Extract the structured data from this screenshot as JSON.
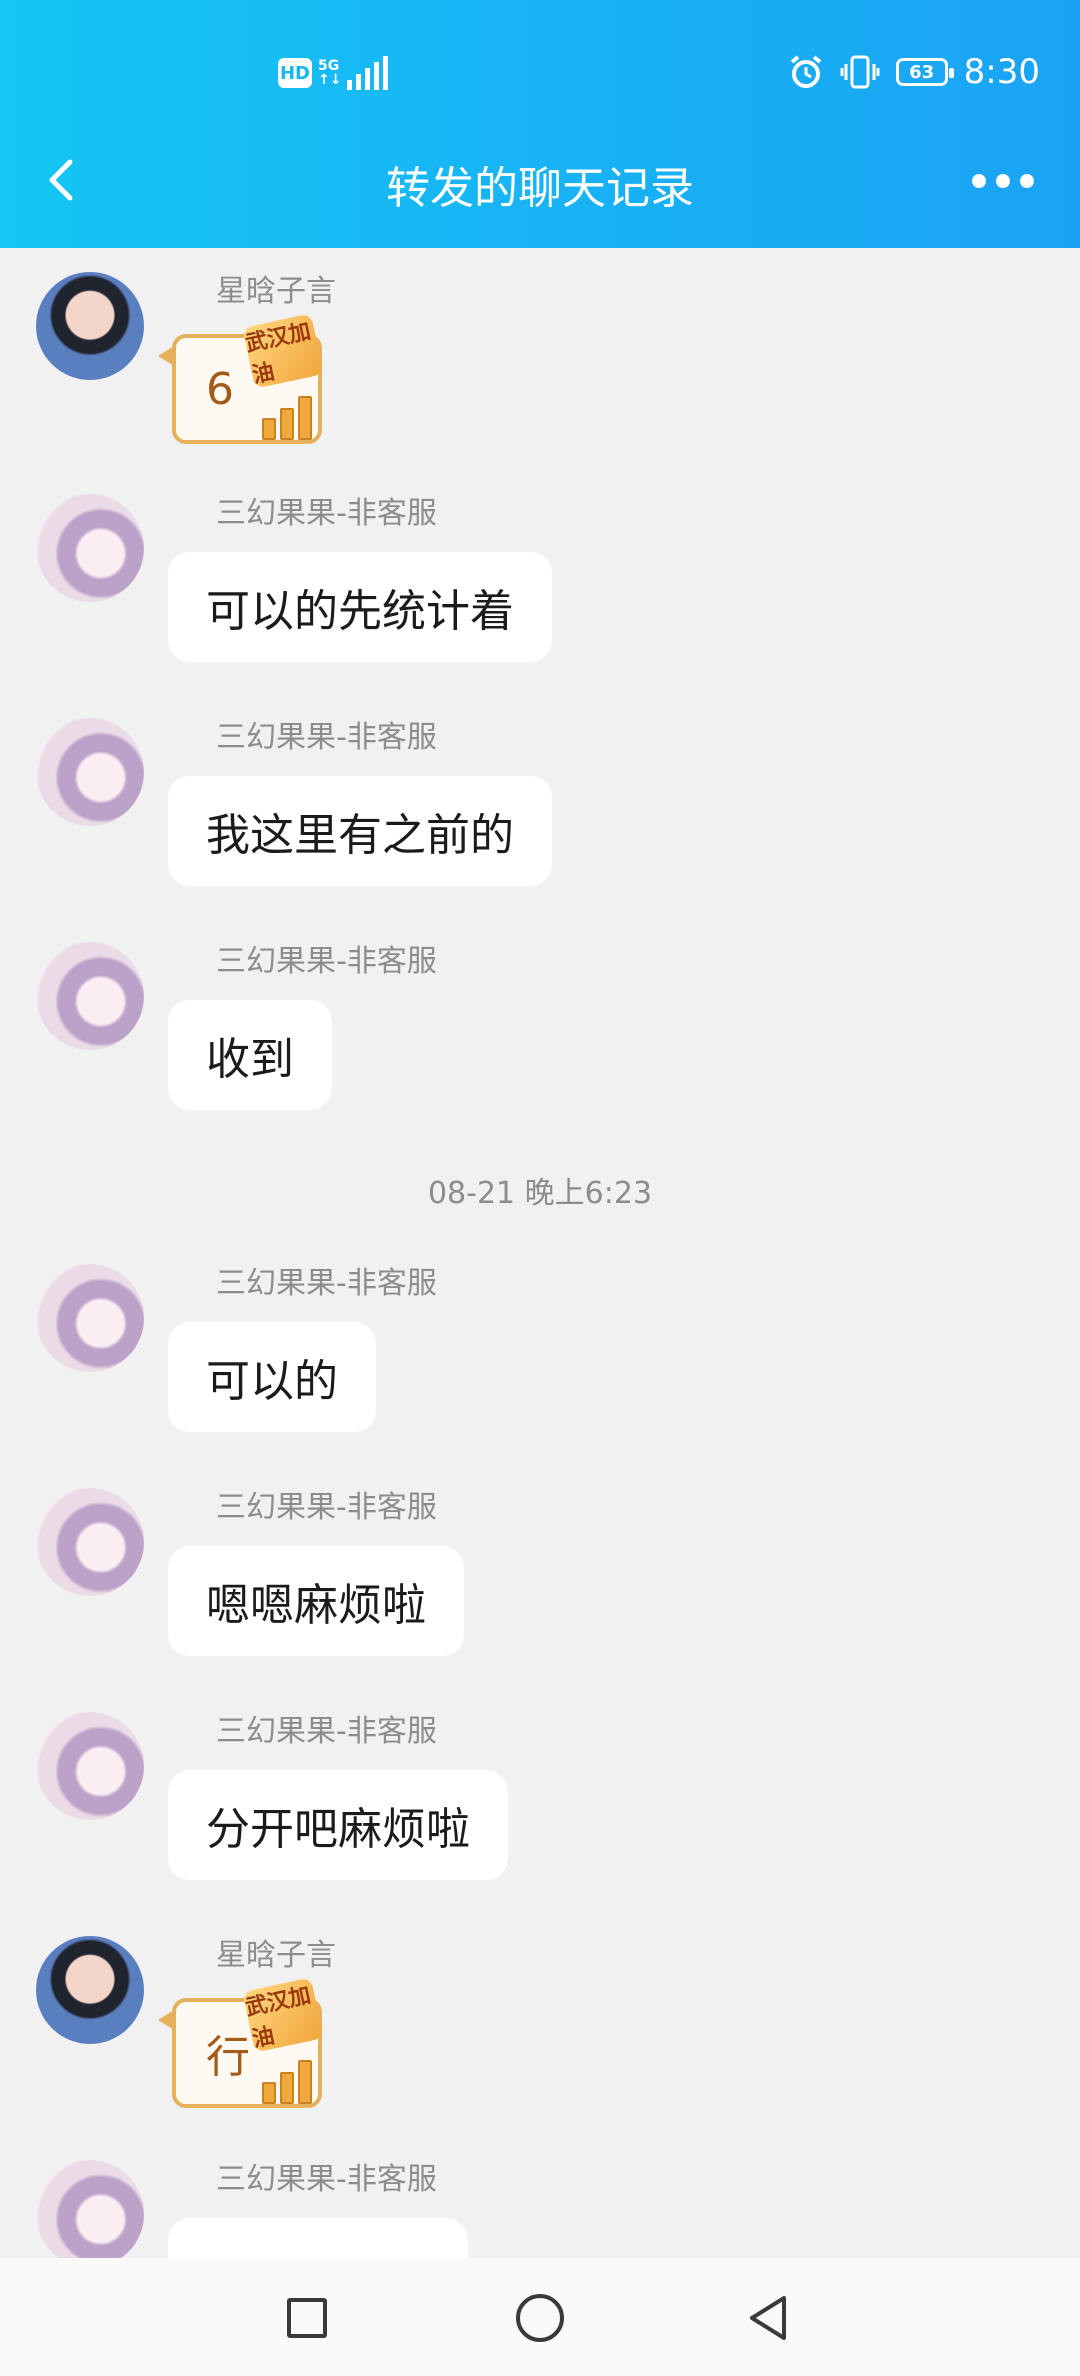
{
  "status_bar": {
    "network": "HD",
    "network_type": "5G",
    "battery": "63",
    "time": "8:30"
  },
  "header": {
    "title": "转发的聊天记录"
  },
  "messages": [
    {
      "sender": "星晗子言",
      "text": "6",
      "type": "sticker",
      "avatar": "boy-avatar",
      "badge": "武汉加油"
    },
    {
      "sender": "三幻果果-非客服",
      "text": "可以的先统计着",
      "type": "text",
      "avatar": "girl-avatar"
    },
    {
      "sender": "三幻果果-非客服",
      "text": "我这里有之前的",
      "type": "text",
      "avatar": "girl-avatar"
    },
    {
      "sender": "三幻果果-非客服",
      "text": "收到",
      "type": "text",
      "avatar": "girl-avatar"
    },
    {
      "sender": "三幻果果-非客服",
      "text": "可以的",
      "type": "text",
      "avatar": "girl-avatar"
    },
    {
      "sender": "三幻果果-非客服",
      "text": "嗯嗯麻烦啦",
      "type": "text",
      "avatar": "girl-avatar"
    },
    {
      "sender": "三幻果果-非客服",
      "text": "分开吧麻烦啦",
      "type": "text",
      "avatar": "girl-avatar"
    },
    {
      "sender": "星晗子言",
      "text": "行",
      "type": "sticker",
      "avatar": "boy-avatar",
      "badge": "武汉加油"
    },
    {
      "sender": "三幻果果-非客服",
      "text": "",
      "type": "text",
      "avatar": "girl-avatar"
    }
  ],
  "timestamp": "08-21 晚上6:23",
  "colors": {
    "header_gradient_start": "#14c6f3",
    "header_gradient_end": "#1aa3f4",
    "background": "#f1f1f1",
    "bubble": "#ffffff",
    "sender_text": "#8c8c8c"
  }
}
